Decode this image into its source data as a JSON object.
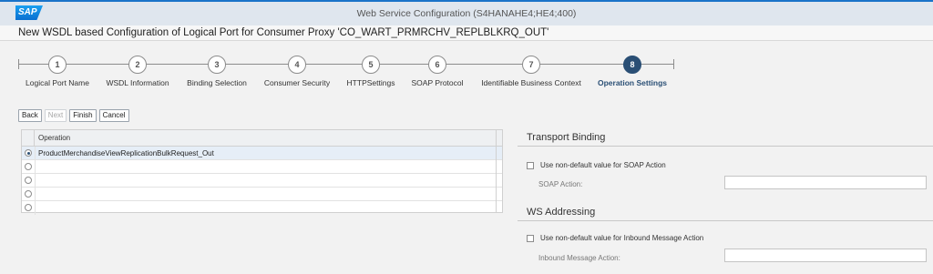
{
  "window": {
    "logo": "SAP",
    "title": "Web Service Configuration (S4HANAHE4;HE4;400)"
  },
  "page_title": "New WSDL based Configuration of Logical Port for Consumer Proxy 'CO_WART_PRMRCHV_REPLBLKRQ_OUT'",
  "wizard": {
    "steps": [
      {
        "number": "1",
        "label": "Logical Port Name",
        "active": false
      },
      {
        "number": "2",
        "label": "WSDL Information",
        "active": false
      },
      {
        "number": "3",
        "label": "Binding Selection",
        "active": false
      },
      {
        "number": "4",
        "label": "Consumer Security",
        "active": false
      },
      {
        "number": "5",
        "label": "HTTPSettings",
        "active": false
      },
      {
        "number": "6",
        "label": "SOAP Protocol",
        "active": false
      },
      {
        "number": "7",
        "label": "Identifiable Business Context",
        "active": false
      },
      {
        "number": "8",
        "label": "Operation Settings",
        "active": true
      }
    ]
  },
  "toolbar": {
    "back_label": "Back",
    "next_label": "Next",
    "finish_label": "Finish",
    "cancel_label": "Cancel"
  },
  "operations_table": {
    "column_header": "Operation",
    "rows": [
      {
        "operation": "ProductMerchandiseViewReplicationBulkRequest_Out",
        "selected": true
      },
      {
        "operation": "",
        "selected": false
      },
      {
        "operation": "",
        "selected": false
      },
      {
        "operation": "",
        "selected": false
      },
      {
        "operation": "",
        "selected": false
      }
    ]
  },
  "transport_binding": {
    "title": "Transport Binding",
    "checkbox_label": "Use non-default value for SOAP Action",
    "checkbox_checked": false,
    "field_label": "SOAP Action:",
    "field_value": ""
  },
  "ws_addressing": {
    "title": "WS Addressing",
    "checkbox_label": "Use non-default value for Inbound Message Action",
    "checkbox_checked": false,
    "field_label": "Inbound Message Action:",
    "field_value": ""
  },
  "colors": {
    "accent": "#2a4f75",
    "topbar_line": "#1a73c9",
    "selected_row": "#e6eef7"
  }
}
